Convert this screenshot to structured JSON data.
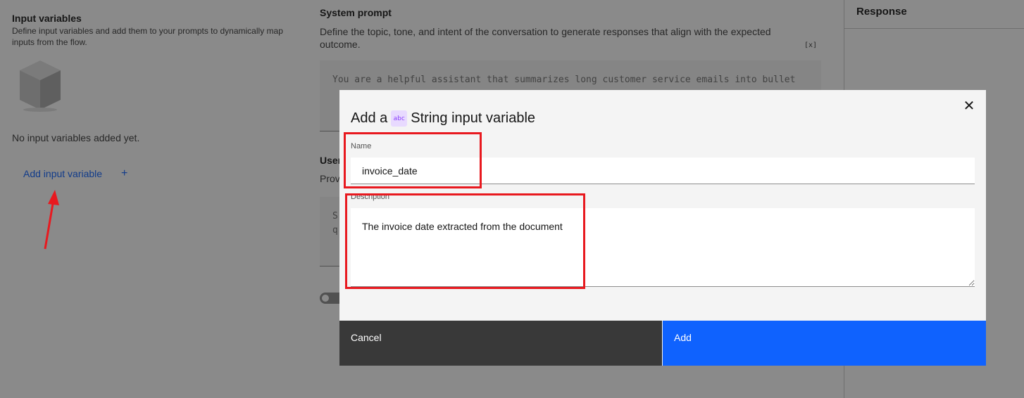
{
  "input_variables": {
    "title": "Input variables",
    "description": "Define input variables and add them to your prompts to dynamically map inputs from the flow.",
    "empty_text": "No input variables added yet.",
    "add_label": "Add input variable",
    "add_plus": "+",
    "empty_icon": "box-icon"
  },
  "system_prompt": {
    "title": "System prompt",
    "description": "Define the topic, tone, and intent of the conversation to generate responses that align with the expected outcome.",
    "var_button": "[x]",
    "placeholder": "You are a helpful assistant that summarizes long customer service emails into bullet"
  },
  "user_prompt": {
    "title": "User",
    "description": "Prov",
    "placeholder_line1": "S",
    "placeholder_line2": "q"
  },
  "response": {
    "title": "Response"
  },
  "modal": {
    "title_prefix": "Add a",
    "type_icon_label": "abc",
    "title_suffix": "String input variable",
    "close_icon": "close-icon",
    "name_label": "Name",
    "name_value": "invoice_date",
    "description_label": "Description",
    "description_value": "The invoice date extracted from the document",
    "cancel_label": "Cancel",
    "add_label": "Add"
  },
  "colors": {
    "accent": "#0f62fe",
    "highlight": "#e8191f",
    "cancel_bg": "#393939",
    "type_icon_bg": "#e8daff"
  }
}
